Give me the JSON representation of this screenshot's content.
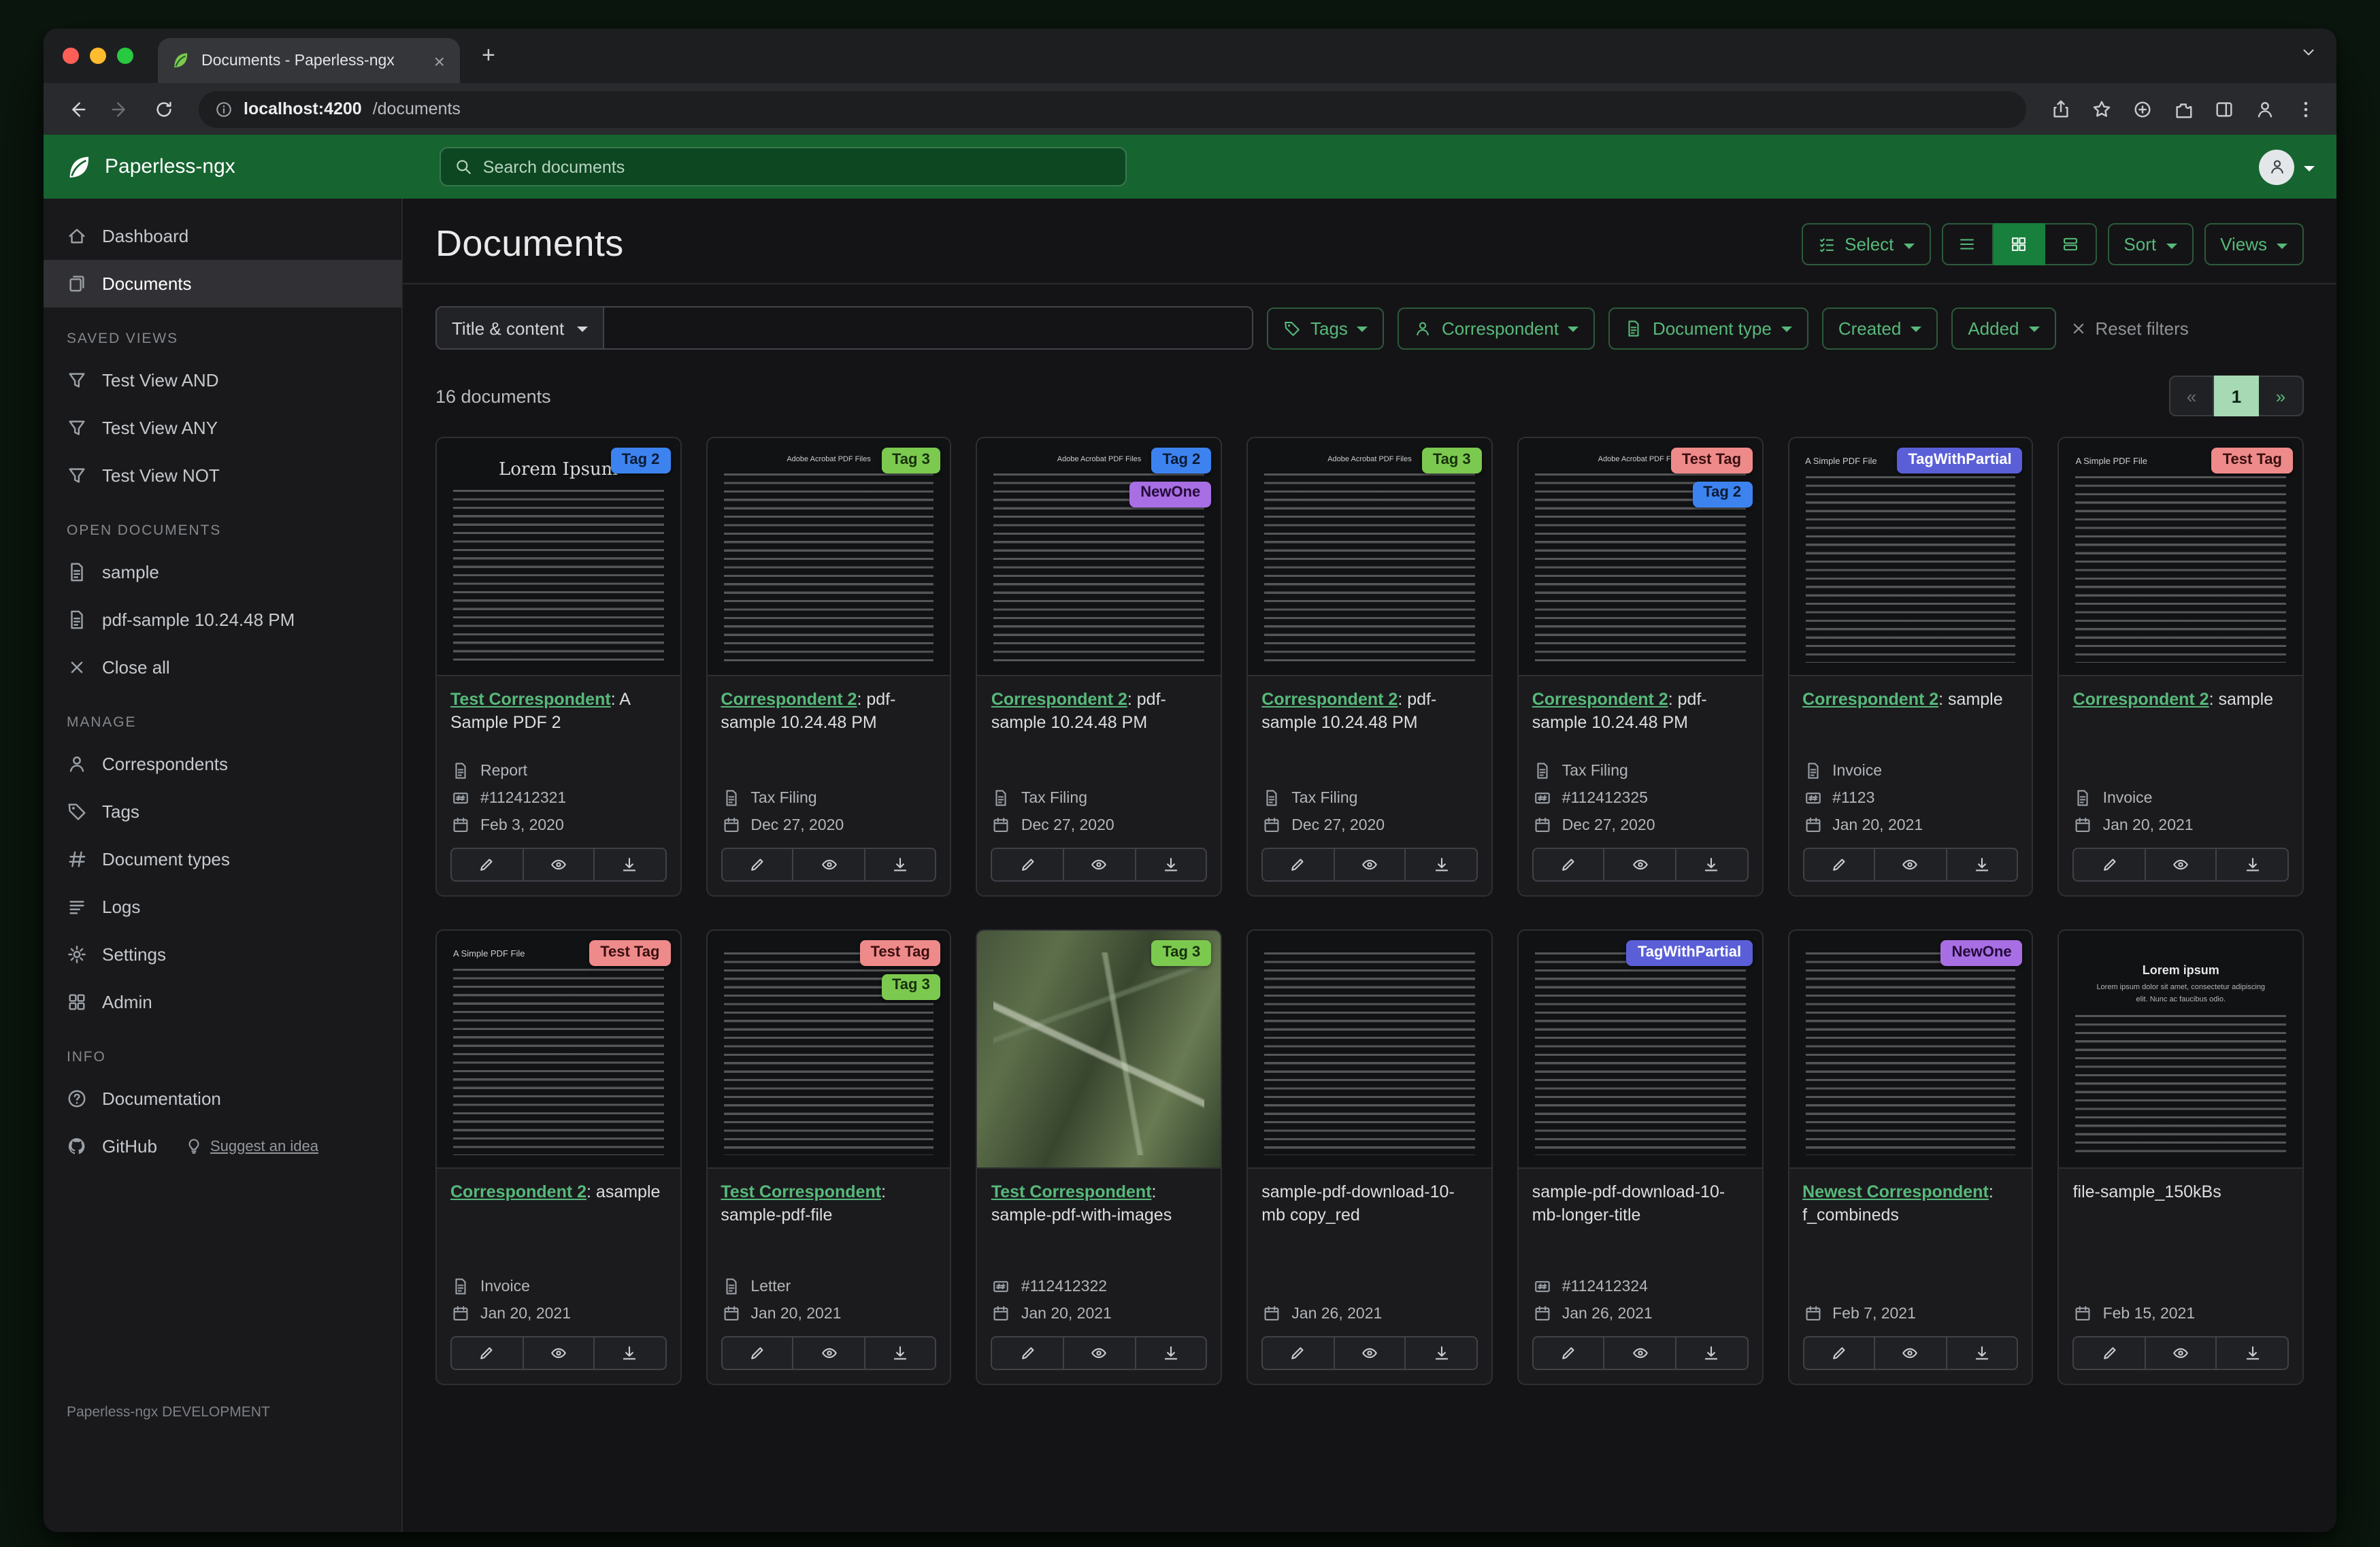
{
  "window": {
    "tab_title": "Documents - Paperless-ngx",
    "tab_close_glyph": "×",
    "new_tab_glyph": "+",
    "url_host": "localhost:4200",
    "url_path": "/documents"
  },
  "app_header": {
    "brand": "Paperless-ngx",
    "search_placeholder": "Search documents"
  },
  "sidebar": {
    "dashboard": "Dashboard",
    "documents": "Documents",
    "saved_views_heading": "SAVED VIEWS",
    "saved_views": [
      "Test View AND",
      "Test View ANY",
      "Test View NOT"
    ],
    "open_documents_heading": "OPEN DOCUMENTS",
    "open_documents": [
      "sample",
      "pdf-sample 10.24.48 PM"
    ],
    "close_all": "Close all",
    "manage_heading": "MANAGE",
    "manage": [
      "Correspondents",
      "Tags",
      "Document types",
      "Logs",
      "Settings",
      "Admin"
    ],
    "info_heading": "INFO",
    "documentation": "Documentation",
    "github": "GitHub",
    "suggest": "Suggest an idea",
    "footer": "Paperless-ngx DEVELOPMENT"
  },
  "page": {
    "title": "Documents",
    "select_label": "Select",
    "sort_label": "Sort",
    "views_label": "Views"
  },
  "filters": {
    "title_content": "Title & content",
    "tags": "Tags",
    "correspondent": "Correspondent",
    "document_type": "Document type",
    "created": "Created",
    "added": "Added",
    "reset": "Reset filters"
  },
  "results": {
    "count": "16 documents",
    "page_prev": "«",
    "page_current": "1",
    "page_next": "»"
  },
  "colors": {
    "header_green": "#166430",
    "accent_green": "#57b97a",
    "active_toggle_green": "#17803c",
    "pagination_active": "#a7d9b4"
  },
  "cards": [
    {
      "thumb": {
        "kind": "lorem",
        "heading": "Lorem Ipsum"
      },
      "tags": [
        {
          "label": "Tag 2",
          "bg": "#3d83f0",
          "fg": "#0b1b33"
        }
      ],
      "correspondent": "Test Correspondent",
      "title_rest": ": A Sample PDF 2",
      "meta": [
        {
          "icon": "doctype",
          "text": "Report"
        },
        {
          "icon": "asn",
          "text": "#112412321"
        },
        {
          "icon": "date",
          "text": "Feb 3, 2020"
        }
      ]
    },
    {
      "thumb": {
        "kind": "acrobat",
        "heading": "Adobe Acrobat PDF Files"
      },
      "tags": [
        {
          "label": "Tag 3",
          "bg": "#7cc94f",
          "fg": "#17300d"
        }
      ],
      "correspondent": "Correspondent 2",
      "title_rest": ": pdf-sample 10.24.48 PM",
      "meta": [
        {
          "icon": "doctype",
          "text": "Tax Filing"
        },
        {
          "icon": "date",
          "text": "Dec 27, 2020"
        }
      ]
    },
    {
      "thumb": {
        "kind": "acrobat",
        "heading": "Adobe Acrobat PDF Files"
      },
      "tags": [
        {
          "label": "Tag 2",
          "bg": "#3d83f0",
          "fg": "#0b1b33"
        },
        {
          "label": "NewOne",
          "bg": "#a86ee3",
          "fg": "#230b3a"
        }
      ],
      "correspondent": "Correspondent 2",
      "title_rest": ": pdf-sample 10.24.48 PM",
      "meta": [
        {
          "icon": "doctype",
          "text": "Tax Filing"
        },
        {
          "icon": "date",
          "text": "Dec 27, 2020"
        }
      ]
    },
    {
      "thumb": {
        "kind": "acrobat",
        "heading": "Adobe Acrobat PDF Files"
      },
      "tags": [
        {
          "label": "Tag 3",
          "bg": "#7cc94f",
          "fg": "#17300d"
        }
      ],
      "correspondent": "Correspondent 2",
      "title_rest": ": pdf-sample 10.24.48 PM",
      "meta": [
        {
          "icon": "doctype",
          "text": "Tax Filing"
        },
        {
          "icon": "date",
          "text": "Dec 27, 2020"
        }
      ]
    },
    {
      "thumb": {
        "kind": "acrobat",
        "heading": "Adobe Acrobat PDF Files"
      },
      "tags": [
        {
          "label": "Test Tag",
          "bg": "#ee8a8a",
          "fg": "#3a0f0f"
        },
        {
          "label": "Tag 2",
          "bg": "#3d83f0",
          "fg": "#0b1b33"
        }
      ],
      "correspondent": "Correspondent 2",
      "title_rest": ": pdf-sample 10.24.48 PM",
      "meta": [
        {
          "icon": "doctype",
          "text": "Tax Filing"
        },
        {
          "icon": "asn",
          "text": "#112412325"
        },
        {
          "icon": "date",
          "text": "Dec 27, 2020"
        }
      ]
    },
    {
      "thumb": {
        "kind": "simple",
        "heading": "A Simple PDF File"
      },
      "tags": [
        {
          "label": "TagWithPartial",
          "bg": "#5a5fd8",
          "fg": "#ffffff"
        }
      ],
      "correspondent": "Correspondent 2",
      "title_rest": ": sample",
      "meta": [
        {
          "icon": "doctype",
          "text": "Invoice"
        },
        {
          "icon": "asn",
          "text": "#1123"
        },
        {
          "icon": "date",
          "text": "Jan 20, 2021"
        }
      ]
    },
    {
      "thumb": {
        "kind": "simple",
        "heading": "A Simple PDF File"
      },
      "tags": [
        {
          "label": "Test Tag",
          "bg": "#ee8a8a",
          "fg": "#3a0f0f"
        }
      ],
      "correspondent": "Correspondent 2",
      "title_rest": ": sample",
      "meta": [
        {
          "icon": "doctype",
          "text": "Invoice"
        },
        {
          "icon": "date",
          "text": "Jan 20, 2021"
        }
      ]
    },
    {
      "thumb": {
        "kind": "simple",
        "heading": "A Simple PDF File"
      },
      "tags": [
        {
          "label": "Test Tag",
          "bg": "#ee8a8a",
          "fg": "#3a0f0f"
        }
      ],
      "correspondent": "Correspondent 2",
      "title_rest": ": asample",
      "meta": [
        {
          "icon": "doctype",
          "text": "Invoice"
        },
        {
          "icon": "date",
          "text": "Jan 20, 2021"
        }
      ]
    },
    {
      "thumb": {
        "kind": "text"
      },
      "tags": [
        {
          "label": "Test Tag",
          "bg": "#ee8a8a",
          "fg": "#3a0f0f"
        },
        {
          "label": "Tag 3",
          "bg": "#7cc94f",
          "fg": "#17300d"
        }
      ],
      "correspondent": "Test Correspondent",
      "title_rest": ": sample-pdf-file",
      "meta": [
        {
          "icon": "doctype",
          "text": "Letter"
        },
        {
          "icon": "date",
          "text": "Jan 20, 2021"
        }
      ]
    },
    {
      "thumb": {
        "kind": "map"
      },
      "tags": [
        {
          "label": "Tag 3",
          "bg": "#7cc94f",
          "fg": "#17300d"
        }
      ],
      "correspondent": "Test Correspondent",
      "title_rest": ": sample-pdf-with-images",
      "meta": [
        {
          "icon": "asn",
          "text": "#112412322"
        },
        {
          "icon": "date",
          "text": "Jan 20, 2021"
        }
      ]
    },
    {
      "thumb": {
        "kind": "text"
      },
      "tags": [],
      "title": "sample-pdf-download-10-mb copy_red",
      "meta": [
        {
          "icon": "date",
          "text": "Jan 26, 2021"
        }
      ]
    },
    {
      "thumb": {
        "kind": "text"
      },
      "tags": [
        {
          "label": "TagWithPartial",
          "bg": "#5a5fd8",
          "fg": "#ffffff"
        }
      ],
      "title": "sample-pdf-download-10-mb-longer-title",
      "meta": [
        {
          "icon": "asn",
          "text": "#112412324"
        },
        {
          "icon": "date",
          "text": "Jan 26, 2021"
        }
      ]
    },
    {
      "thumb": {
        "kind": "text"
      },
      "tags": [
        {
          "label": "NewOne",
          "bg": "#a86ee3",
          "fg": "#230b3a"
        }
      ],
      "correspondent": "Newest Correspondent",
      "title_rest": ": f_combineds",
      "meta": [
        {
          "icon": "date",
          "text": "Feb 7, 2021"
        }
      ]
    },
    {
      "thumb": {
        "kind": "lorem2",
        "heading": "Lorem ipsum",
        "subtext": "Lorem ipsum dolor sit amet, consectetur adipiscing elit. Nunc ac faucibus odio."
      },
      "tags": [],
      "title": "file-sample_150kBs",
      "meta": [
        {
          "icon": "date",
          "text": "Feb 15, 2021"
        }
      ]
    }
  ]
}
